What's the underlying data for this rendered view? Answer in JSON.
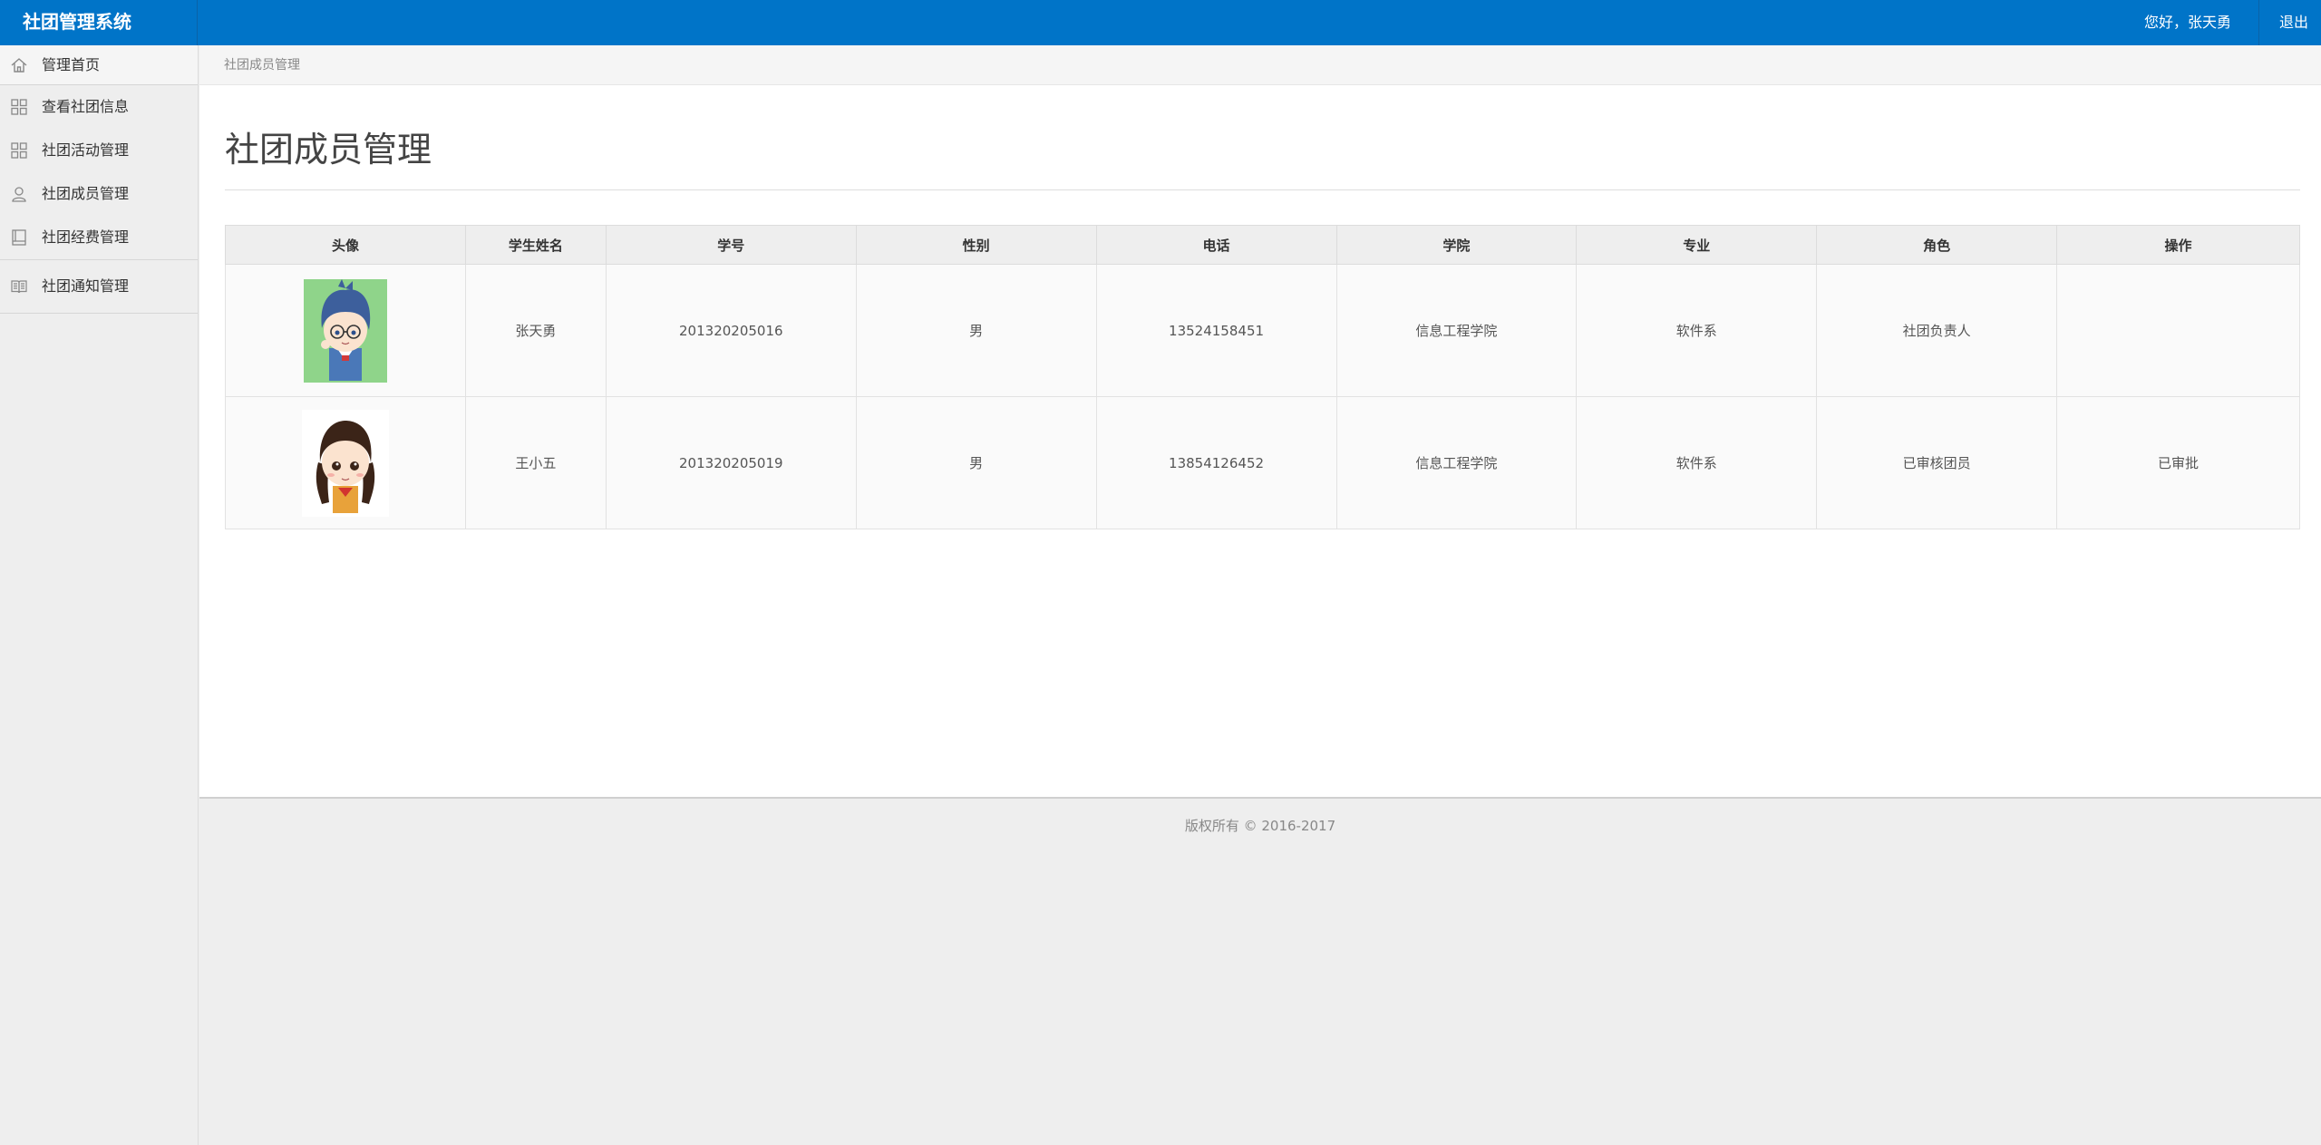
{
  "app": {
    "title": "社团管理系统"
  },
  "header": {
    "greeting": "您好，张天勇",
    "logout_label": "退出"
  },
  "sidebar": {
    "items": [
      {
        "label": "管理首页",
        "icon": "home-icon"
      },
      {
        "label": "查看社团信息",
        "icon": "grid-icon"
      },
      {
        "label": "社团活动管理",
        "icon": "grid-icon"
      },
      {
        "label": "社团成员管理",
        "icon": "user-icon"
      },
      {
        "label": "社团经费管理",
        "icon": "ledger-icon"
      },
      {
        "label": "社团通知管理",
        "icon": "book-icon"
      }
    ]
  },
  "breadcrumb": "社团成员管理",
  "page": {
    "title": "社团成员管理"
  },
  "table": {
    "headers": [
      "头像",
      "学生姓名",
      "学号",
      "性别",
      "电话",
      "学院",
      "专业",
      "角色",
      "操作"
    ],
    "rows": [
      {
        "name": "张天勇",
        "id": "201320205016",
        "gender": "男",
        "phone": "13524158451",
        "college": "信息工程学院",
        "major": "软件系",
        "role": "社团负责人",
        "action": ""
      },
      {
        "name": "王小五",
        "id": "201320205019",
        "gender": "男",
        "phone": "13854126452",
        "college": "信息工程学院",
        "major": "软件系",
        "role": "已审核团员",
        "action": "已审批"
      }
    ]
  },
  "footer": "版权所有 © 2016-2017",
  "colors": {
    "topbar": "#0074c8",
    "sidebar": "#eeeeee",
    "content": "#ffffff"
  }
}
